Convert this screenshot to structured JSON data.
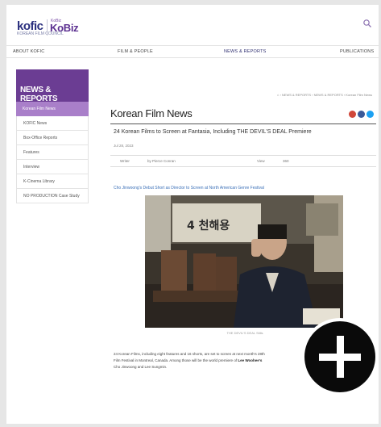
{
  "header": {
    "logo_kofic": "kofic",
    "logo_kofic_sub": "KOREAN FILM COUNCIL",
    "logo_kobiz_top": "KoBiz",
    "logo_kobiz": "KoBiz"
  },
  "nav": {
    "items": [
      "ABOUT KOFIC",
      "FILM & PEOPLE",
      "NEWS & REPORTS",
      "PUBLICATIONS"
    ],
    "active": "NEWS & REPORTS"
  },
  "sidebar": {
    "title": "NEWS & REPORTS",
    "active_sub": "Korean Film News",
    "items": [
      "KOFIC News",
      "Box-Office Reports",
      "Features",
      "Interview",
      "K-Cinema Library",
      "NO PRODUCTION Case Study"
    ]
  },
  "breadcrumb": "⌂ › NEWS & REPORTS › NEWS & REPORTS › Korean Film News",
  "main": {
    "title": "Korean Film News",
    "share_colors": [
      "#d0473a",
      "#3b5998",
      "#1da1f2"
    ],
    "article_title": "24 Korean Films to Screen at Fantasia, Including THE DEVIL'S DEAL Premiere",
    "date": "Jul 28, 2023",
    "meta_writer_label": "Writer",
    "meta_writer": "by Pierce Conran",
    "meta_views_label": "View",
    "meta_views": "360",
    "lead_link": "Cho Jinwoong's Debut Short as Director to Screen at North American Genre Festival",
    "photo_sign": "4 천해용",
    "photo_caption": "THE DEVIL'S DEAL Stills",
    "body_lines": [
      "24 Korean Films, including eight features and 16 shorts, are set to screen at next month's 28th",
      "Film Festival in Montreal, Canada. Among those will be the world premiere of",
      "Cho Jinwoong and Lee Sungmin."
    ],
    "body_bold_1": "Lee Woohee's",
    "body_tail_1": "",
    "body_bold_2": "Cho Jinwoong",
    "body_bold_3": "Lee Sungmin"
  },
  "overlay": {
    "icon": "plus-icon"
  }
}
